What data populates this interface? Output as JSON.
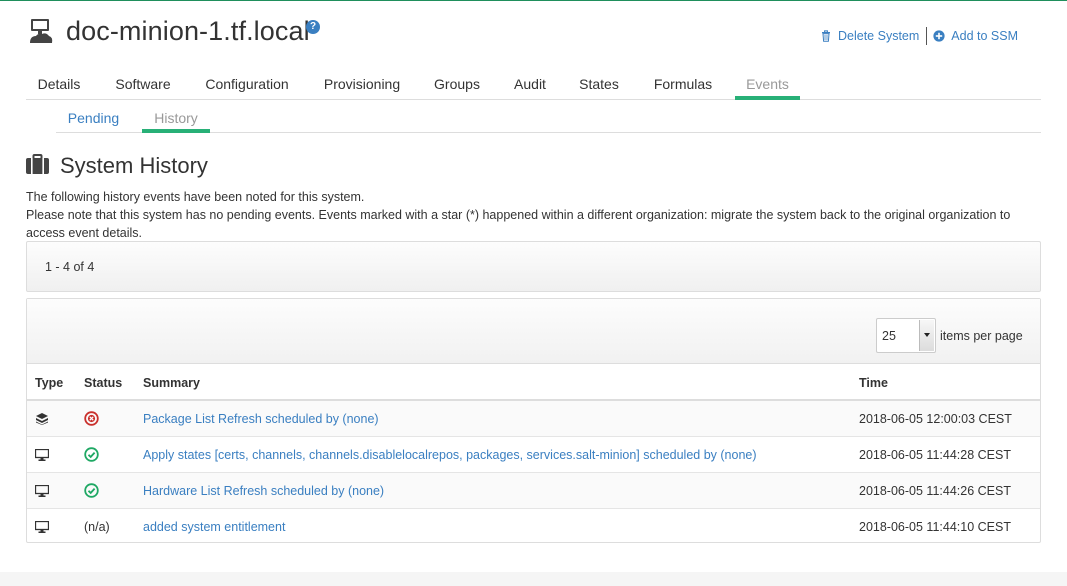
{
  "header": {
    "system_name": "doc-minion-1.tf.local",
    "help_icon": "question-circle-icon",
    "actions": [
      {
        "label": "Delete System",
        "icon": "trash-icon"
      },
      {
        "label": "Add to SSM",
        "icon": "plus-circle-icon"
      }
    ]
  },
  "tabs": [
    {
      "label": "Details"
    },
    {
      "label": "Software"
    },
    {
      "label": "Configuration"
    },
    {
      "label": "Provisioning"
    },
    {
      "label": "Groups"
    },
    {
      "label": "Audit"
    },
    {
      "label": "States"
    },
    {
      "label": "Formulas"
    },
    {
      "label": "Events",
      "active": true
    }
  ],
  "subtabs": [
    {
      "label": "Pending"
    },
    {
      "label": "History",
      "active": true
    }
  ],
  "section": {
    "title": "System History",
    "icon": "suitcase-icon",
    "description_line1": "The following history events have been noted for this system.",
    "description_line2": "Please note that this system has no pending events. Events marked with a star (*) happened within a different organization: migrate the system back to the original organization to access event details."
  },
  "pagination": {
    "range_text": "1 - 4 of 4",
    "per_page_value": "25",
    "per_page_label": "items per page"
  },
  "table": {
    "columns": [
      "Type",
      "Status",
      "Summary",
      "Time"
    ],
    "rows": [
      {
        "type_icon": "package-icon",
        "status_icon": "failed-icon",
        "status_text": "",
        "summary": "Package List Refresh scheduled by (none)",
        "time": "2018-06-05 12:00:03 CEST"
      },
      {
        "type_icon": "monitor-icon",
        "status_icon": "completed-icon",
        "status_text": "",
        "summary": "Apply states [certs, channels, channels.disablelocalrepos, packages, services.salt-minion] scheduled by (none)",
        "time": "2018-06-05 11:44:28 CEST"
      },
      {
        "type_icon": "monitor-icon",
        "status_icon": "completed-icon",
        "status_text": "",
        "summary": "Hardware List Refresh scheduled by (none)",
        "time": "2018-06-05 11:44:26 CEST"
      },
      {
        "type_icon": "monitor-icon",
        "status_icon": "",
        "status_text": "(n/a)",
        "summary": "added system entitlement",
        "time": "2018-06-05 11:44:10 CEST"
      }
    ]
  },
  "colors": {
    "accent_green": "#28b077",
    "link_blue": "#3a7fc1",
    "error_red": "#c9302c",
    "success_green": "#1fa864"
  }
}
